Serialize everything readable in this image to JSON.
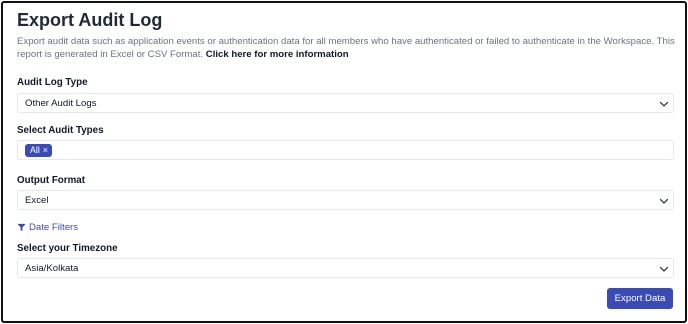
{
  "page": {
    "title": "Export Audit Log",
    "description": "Export audit data such as application events or authentication data for all members who have authenticated or failed to authenticate in the Workspace. This report is generated in Excel or CSV Format.",
    "more_info_link": "Click here for more information"
  },
  "audit_log_type": {
    "label": "Audit Log Type",
    "value": "Other Audit Logs",
    "icon": "chevron-down-icon"
  },
  "audit_types": {
    "label": "Select Audit Types",
    "selected": [
      "All"
    ],
    "chip_remove_glyph": "×"
  },
  "output_format": {
    "label": "Output Format",
    "value": "Excel",
    "icon": "chevron-down-icon"
  },
  "date_filters": {
    "label": "Date Filters",
    "icon": "filter-icon"
  },
  "timezone": {
    "label": "Select your Timezone",
    "value": "Asia/Kolkata",
    "icon": "chevron-down-icon"
  },
  "actions": {
    "export_label": "Export Data"
  },
  "colors": {
    "accent": "#3b4bb5",
    "text_muted": "#6b7280",
    "border": "#e5e7eb"
  }
}
